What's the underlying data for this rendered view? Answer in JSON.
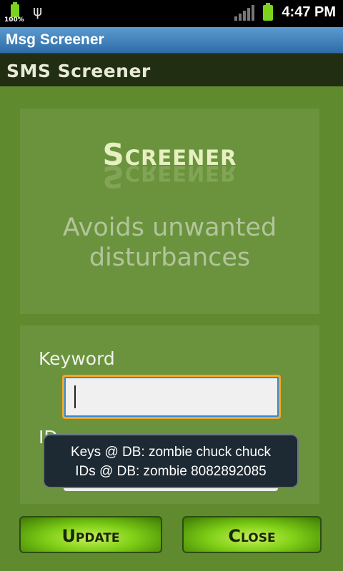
{
  "statusbar": {
    "battery_percent": "100%",
    "time": "4:47 PM",
    "icons": [
      "battery-icon",
      "usb-icon",
      "signal-icon",
      "battery-icon"
    ]
  },
  "titlebar": {
    "title": "Msg Screener"
  },
  "header": {
    "title": "SMS Screener"
  },
  "hero": {
    "logo_text": "Screener",
    "tagline_line1": "Avoids unwanted",
    "tagline_line2": "disturbances"
  },
  "form": {
    "keyword_label": "Keyword",
    "keyword_value": "",
    "id_label": "ID"
  },
  "toast": {
    "line1": "Keys @ DB: zombie chuck chuck",
    "line2": "IDs @ DB: zombie  8082892085"
  },
  "buttons": {
    "update": "Update",
    "close": "Close"
  },
  "colors": {
    "background": "#5f8a2e",
    "titlebar": "#2d6ca7",
    "button": "#7fcf16",
    "input_focus": "#f5a623"
  }
}
